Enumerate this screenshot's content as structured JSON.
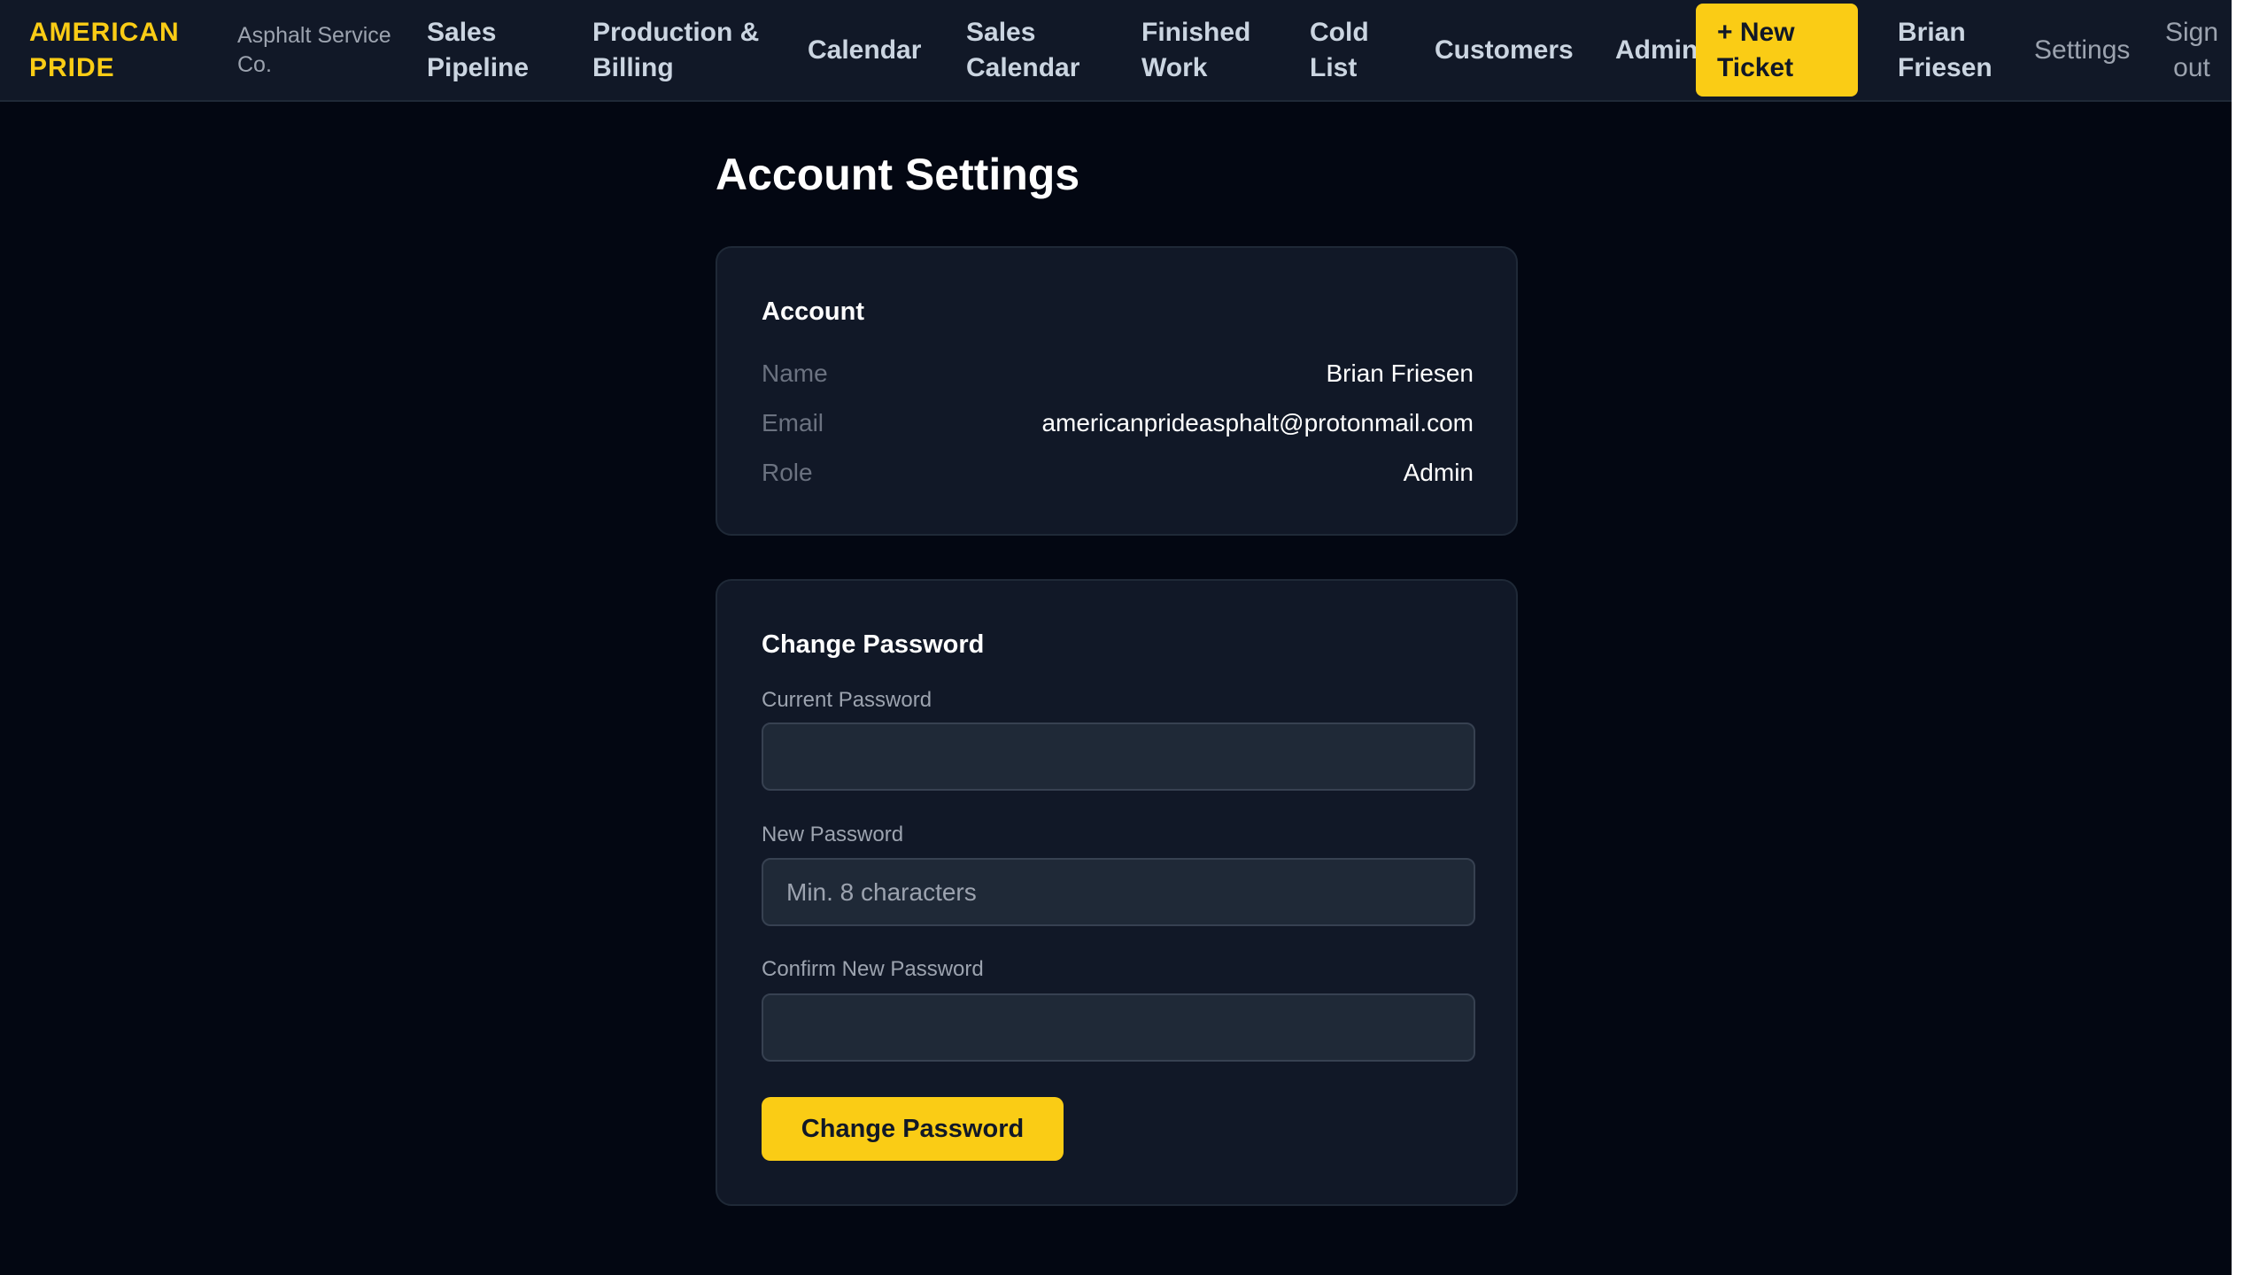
{
  "brand": {
    "name": "AMERICAN PRIDE",
    "tagline": "Asphalt Service Co."
  },
  "nav": {
    "sales_pipeline": "Sales Pipeline",
    "production_billing": "Production & Billing",
    "calendar": "Calendar",
    "sales_calendar": "Sales Calendar",
    "finished_work": "Finished Work",
    "cold_list": "Cold List",
    "customers": "Customers",
    "admin": "Admin",
    "new_ticket": "+ New Ticket",
    "user_name": "Brian Friesen",
    "settings": "Settings",
    "sign_out": "Sign out"
  },
  "page": {
    "title": "Account Settings"
  },
  "account": {
    "heading": "Account",
    "rows": [
      {
        "label": "Name",
        "value": "Brian Friesen"
      },
      {
        "label": "Email",
        "value": "americanprideasphalt@protonmail.com"
      },
      {
        "label": "Role",
        "value": "Admin"
      }
    ]
  },
  "change_password": {
    "heading": "Change Password",
    "current_label": "Current Password",
    "current_value": "",
    "current_placeholder": "",
    "new_label": "New Password",
    "new_value": "",
    "new_placeholder": "Min. 8 characters",
    "confirm_label": "Confirm New Password",
    "confirm_value": "",
    "confirm_placeholder": "",
    "submit_label": "Change Password"
  },
  "colors": {
    "accent": "#facc15",
    "background": "#030712",
    "nav_background": "#111827",
    "card_background": "#111827",
    "input_background": "#1f2937"
  }
}
